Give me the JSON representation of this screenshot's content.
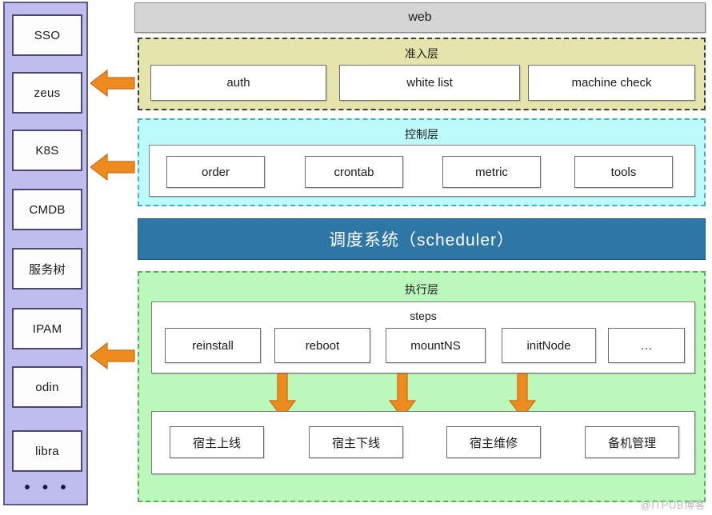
{
  "colors": {
    "sidebar_bg": "#BEBDEE",
    "web_bar_bg": "#D5D5D5",
    "admit_bg": "#E6E4AD",
    "control_bg": "#BDFBFB",
    "scheduler_bg": "#2E76A6",
    "exec_bg": "#BCF8BC",
    "arrow": "#EE8B1F",
    "arrow_border": "#C96A10",
    "node_bg": "#FFFFFF",
    "watermark": "#B9B9B9"
  },
  "sidebar": {
    "items": [
      {
        "label": "SSO"
      },
      {
        "label": "zeus"
      },
      {
        "label": "K8S"
      },
      {
        "label": "CMDB"
      },
      {
        "label": "服务树"
      },
      {
        "label": "IPAM"
      },
      {
        "label": "odin"
      },
      {
        "label": "libra"
      }
    ],
    "more_indicator": "• • •"
  },
  "web": {
    "label": "web"
  },
  "admit_layer": {
    "title": "准入层",
    "nodes": [
      {
        "label": "auth"
      },
      {
        "label": "white list"
      },
      {
        "label": "machine check"
      }
    ]
  },
  "control_layer": {
    "title": "控制层",
    "nodes": [
      {
        "label": "order"
      },
      {
        "label": "crontab"
      },
      {
        "label": "metric"
      },
      {
        "label": "tools"
      }
    ]
  },
  "scheduler": {
    "label": "调度系统（scheduler）"
  },
  "exec_layer": {
    "title": "执行层",
    "steps_label": "steps",
    "steps": [
      {
        "label": "reinstall"
      },
      {
        "label": "reboot"
      },
      {
        "label": "mountNS"
      },
      {
        "label": "initNode"
      },
      {
        "label": "…"
      }
    ],
    "operations": [
      {
        "label": "宿主上线"
      },
      {
        "label": "宿主下线"
      },
      {
        "label": "宿主维修"
      },
      {
        "label": "备机管理"
      }
    ]
  },
  "arrows": {
    "left_arrows": [
      {
        "name": "arrow-admit-to-sidebar"
      },
      {
        "name": "arrow-control-to-sidebar"
      },
      {
        "name": "arrow-exec-to-sidebar"
      }
    ],
    "down_arrows": [
      {
        "name": "arrow-steps-to-op-1"
      },
      {
        "name": "arrow-steps-to-op-2"
      },
      {
        "name": "arrow-steps-to-op-3"
      }
    ]
  },
  "watermark": {
    "text": "@ITPUB博客"
  }
}
